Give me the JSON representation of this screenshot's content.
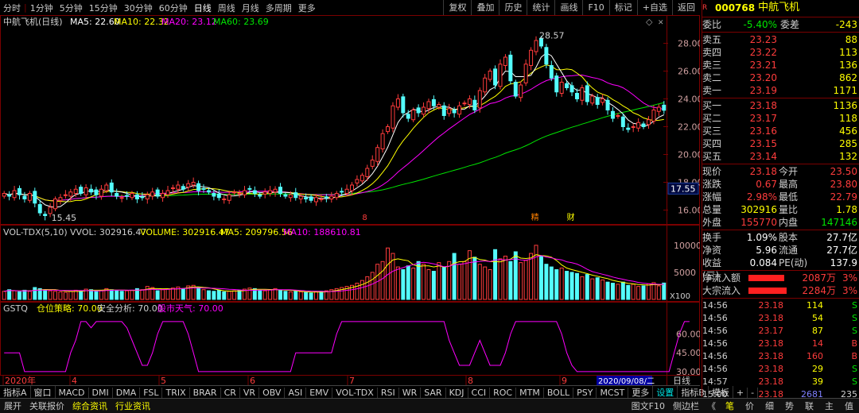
{
  "periods": [
    "分时",
    "1分钟",
    "5分钟",
    "15分钟",
    "30分钟",
    "60分钟",
    "日线",
    "周线",
    "月线",
    "多周期",
    "更多"
  ],
  "active_period": "日线",
  "toolbar": [
    "复权",
    "叠加",
    "历史",
    "统计",
    "画线",
    "F10",
    "标记",
    "+自选",
    "返回"
  ],
  "stock": {
    "code": "000768",
    "name": "中航飞机",
    "title": "中航飞机(日线)"
  },
  "ma_legend": {
    "ma5": "MA5: 22.60",
    "ma10": "MA10: 22.32",
    "ma20": "MA20: 23.12",
    "ma60": "MA60: 23.69"
  },
  "vol_legend": {
    "name": "VOL-TDX(5,10)",
    "vvol": "VVOL: 302916.47",
    "volume": "VOLUME: 302916.47",
    "ma5": "MA5: 209796.56",
    "ma10": "MA10: 188610.81"
  },
  "gstq_legend": {
    "name": "GSTQ",
    "cw": "仓位策略: 70.00",
    "aq": "安全分析: 70.00",
    "gs": "股市天气: 70.00"
  },
  "price_axis": [
    "28.00",
    "26.00",
    "24.00",
    "22.00",
    "20.00",
    "18.00",
    "16.00"
  ],
  "price_marker": "17.55",
  "vol_axis": [
    "10000",
    "5000"
  ],
  "vol_unit": "X100",
  "gstq_axis": [
    "60.00",
    "45.00",
    "30.00"
  ],
  "peak_label": "28.57",
  "low_label": "15.45",
  "event_marks": [
    "8",
    "精",
    "财"
  ],
  "months": [
    "2020年",
    "4",
    "5",
    "6",
    "7",
    "8",
    "9"
  ],
  "cursor_date": "2020/09/08/二",
  "period_tag": "日线",
  "indicator_tabs": [
    "指标A",
    "窗口",
    "MACD",
    "DMI",
    "DMA",
    "FSL",
    "TRIX",
    "BRAR",
    "CR",
    "VR",
    "OBV",
    "ASI",
    "EMV",
    "VOL-TDX",
    "RSI",
    "WR",
    "SAR",
    "KDJ",
    "CCI",
    "ROC",
    "MTM",
    "BOLL",
    "PSY",
    "MCST",
    "更多",
    "设置",
    "指标B",
    "模板",
    "+",
    "-"
  ],
  "status_tabs": [
    "展开",
    "关联报价",
    "综合资讯",
    "行业资讯",
    "图文F10",
    "侧边栏",
    "《"
  ],
  "status_right": [
    "笔",
    "价",
    "细",
    "势",
    "联",
    "主",
    "值"
  ],
  "chart_data": {
    "type": "candlestick",
    "closes": [
      17.2,
      17.0,
      17.4,
      17.1,
      16.8,
      17.2,
      16.5,
      15.8,
      15.6,
      16.2,
      16.8,
      16.9,
      17.1,
      17.3,
      17.5,
      17.2,
      17.6,
      17.3,
      17.1,
      17.5,
      17.8,
      17.3,
      17.0,
      16.9,
      17.0,
      17.2,
      16.8,
      16.9,
      17.1,
      17.3,
      17.0,
      17.2,
      17.4,
      17.6,
      17.8,
      17.5,
      17.9,
      18.0,
      17.4,
      17.5,
      17.3,
      17.0,
      16.9,
      16.8,
      17.1,
      17.3,
      17.2,
      17.4,
      17.5,
      17.2,
      17.0,
      17.3,
      17.4,
      17.5,
      17.2,
      17.0,
      17.1,
      16.9,
      17.0,
      16.8,
      16.7,
      16.9,
      16.8,
      16.9,
      17.0,
      17.2,
      17.3,
      17.5,
      17.8,
      18.2,
      18.5,
      19.0,
      19.6,
      20.5,
      21.5,
      22.0,
      23.5,
      24.0,
      23.0,
      22.6,
      23.2,
      23.0,
      23.4,
      23.8,
      23.5,
      23.6,
      22.8,
      23.3,
      23.0,
      23.5,
      23.7,
      24.0,
      23.2,
      24.6,
      25.5,
      26.0,
      25.0,
      26.5,
      27.0,
      25.3,
      24.2,
      25.0,
      26.5,
      27.5,
      28.2,
      27.8,
      26.5,
      25.5,
      24.5,
      25.2,
      24.8,
      24.5,
      24.0,
      24.8,
      23.8,
      24.2,
      23.6,
      24.0,
      23.2,
      22.6,
      22.8,
      22.0,
      21.8,
      22.0,
      22.3,
      22.0,
      22.5,
      23.2,
      23.4,
      23.18
    ],
    "ylim": [
      15.0,
      29.0
    ],
    "volumes": [
      1500,
      1800,
      1600,
      1400,
      1700,
      1500,
      2200,
      2000,
      1800,
      1600,
      1500,
      1400,
      1300,
      1500,
      1700,
      1600,
      1900,
      1800,
      1500,
      1700,
      2000,
      1800,
      1600,
      1500,
      1600,
      1700,
      2000,
      1800,
      2400,
      2200,
      1600,
      1800,
      1900,
      2100,
      2300,
      2000,
      2500,
      2600,
      2200,
      1800,
      1600,
      1500,
      1700,
      1400,
      1500,
      1600,
      1700,
      1900,
      2100,
      2000,
      1700,
      1600,
      1800,
      2000,
      1700,
      1500,
      1400,
      1500,
      1400,
      1300,
      1200,
      1400,
      1500,
      1600,
      1800,
      2000,
      2200,
      2400,
      2600,
      3000,
      3500,
      4200,
      5000,
      6500,
      7000,
      9500,
      8500,
      6000,
      5500,
      6200,
      5800,
      7000,
      6500,
      5500,
      5200,
      6800,
      6000,
      7000,
      8500,
      6500,
      7000,
      9000,
      7800,
      6500,
      6000,
      5500,
      9200,
      7500,
      8000,
      7000,
      8800,
      6800,
      7200,
      8500,
      10000,
      8000,
      6500,
      6000,
      5500,
      5800,
      5200,
      5000,
      4800,
      4200,
      4600,
      3800,
      4000,
      3600,
      3200,
      3000,
      2800,
      3200,
      2600,
      2800,
      2400,
      2500,
      2900,
      3100,
      2500,
      3029
    ],
    "vol_ylim": [
      0,
      11000
    ],
    "gstq": [
      45,
      45,
      45,
      45,
      30,
      30,
      30,
      30,
      30,
      30,
      30,
      30,
      30,
      45,
      55,
      70,
      70,
      65,
      70,
      70,
      70,
      70,
      70,
      70,
      65,
      55,
      45,
      35,
      35,
      45,
      60,
      70,
      70,
      70,
      70,
      70,
      60,
      45,
      30,
      30,
      30,
      30,
      30,
      30,
      30,
      30,
      30,
      30,
      30,
      30,
      30,
      30,
      30,
      30,
      30,
      30,
      30,
      45,
      45,
      45,
      45,
      45,
      45,
      45,
      45,
      60,
      70,
      70,
      70,
      70,
      70,
      70,
      70,
      70,
      70,
      70,
      70,
      70,
      70,
      70,
      70,
      70,
      70,
      70,
      70,
      70,
      70,
      55,
      45,
      35,
      35,
      35,
      45,
      55,
      45,
      35,
      35,
      35,
      45,
      60,
      70,
      70,
      70,
      70,
      70,
      70,
      70,
      70,
      70,
      60,
      45,
      35,
      30,
      30,
      30,
      30,
      30,
      30,
      30,
      30,
      30,
      30,
      30,
      30,
      30,
      30,
      30,
      30,
      30,
      30,
      30,
      45,
      60,
      70,
      70
    ],
    "gstq_ylim": [
      28,
      75
    ]
  },
  "quote": {
    "weibi": "-5.40%",
    "weicha": "-243",
    "asks": [
      {
        "label": "卖五",
        "price": "23.23",
        "vol": "88"
      },
      {
        "label": "卖四",
        "price": "23.22",
        "vol": "113"
      },
      {
        "label": "卖三",
        "price": "23.21",
        "vol": "136"
      },
      {
        "label": "卖二",
        "price": "23.20",
        "vol": "862"
      },
      {
        "label": "卖一",
        "price": "23.19",
        "vol": "1171"
      }
    ],
    "bids": [
      {
        "label": "买一",
        "price": "23.18",
        "vol": "1136"
      },
      {
        "label": "买二",
        "price": "23.17",
        "vol": "118"
      },
      {
        "label": "买三",
        "price": "23.16",
        "vol": "456"
      },
      {
        "label": "买四",
        "price": "23.15",
        "vol": "285"
      },
      {
        "label": "买五",
        "price": "23.14",
        "vol": "132"
      }
    ],
    "stats": [
      {
        "k1": "现价",
        "v1": "23.18",
        "k2": "今开",
        "v2": "23.50"
      },
      {
        "k1": "涨跌",
        "v1": "0.67",
        "k2": "最高",
        "v2": "23.80"
      },
      {
        "k1": "涨幅",
        "v1": "2.98%",
        "k2": "最低",
        "v2": "22.79"
      },
      {
        "k1": "总量",
        "v1": "302916",
        "k2": "量比",
        "v2": "1.78"
      },
      {
        "k1": "外盘",
        "v1": "155770",
        "k2": "内盘",
        "v2": "147146"
      }
    ],
    "stats2": [
      {
        "k1": "换手",
        "v1": "1.09%",
        "k2": "股本",
        "v2": "27.7亿"
      },
      {
        "k1": "净资",
        "v1": "5.96",
        "k2": "流通",
        "v2": "27.7亿"
      },
      {
        "k1": "收益(三)",
        "v1": "0.084",
        "k2": "PE(动)",
        "v2": "137.9"
      }
    ],
    "flows": [
      {
        "label": "净流入额",
        "value": "2087万",
        "pct": "3%",
        "bar": 0.75
      },
      {
        "label": "大宗流入",
        "value": "2284万",
        "pct": "3%",
        "bar": 0.8
      }
    ],
    "ticks": [
      {
        "t": "14:56",
        "p": "23.18",
        "v": "114",
        "d": "S"
      },
      {
        "t": "14:56",
        "p": "23.18",
        "v": "54",
        "d": "S"
      },
      {
        "t": "14:56",
        "p": "23.17",
        "v": "87",
        "d": "S"
      },
      {
        "t": "14:56",
        "p": "23.18",
        "v": "14",
        "d": "B"
      },
      {
        "t": "14:56",
        "p": "23.18",
        "v": "160",
        "d": "B"
      },
      {
        "t": "14:56",
        "p": "23.18",
        "v": "29",
        "d": "S"
      },
      {
        "t": "14:57",
        "p": "23.18",
        "v": "39",
        "d": "S"
      },
      {
        "t": "15:00",
        "p": "23.18",
        "v": "2681",
        "d": "235"
      }
    ]
  },
  "colors": {
    "up": "#ff3c3c",
    "down": "#54fcfc",
    "ma5": "#ffffff",
    "ma10": "#ffff00",
    "ma20": "#ff00ff",
    "ma60": "#00e600",
    "gstq": "#ff00ff"
  }
}
